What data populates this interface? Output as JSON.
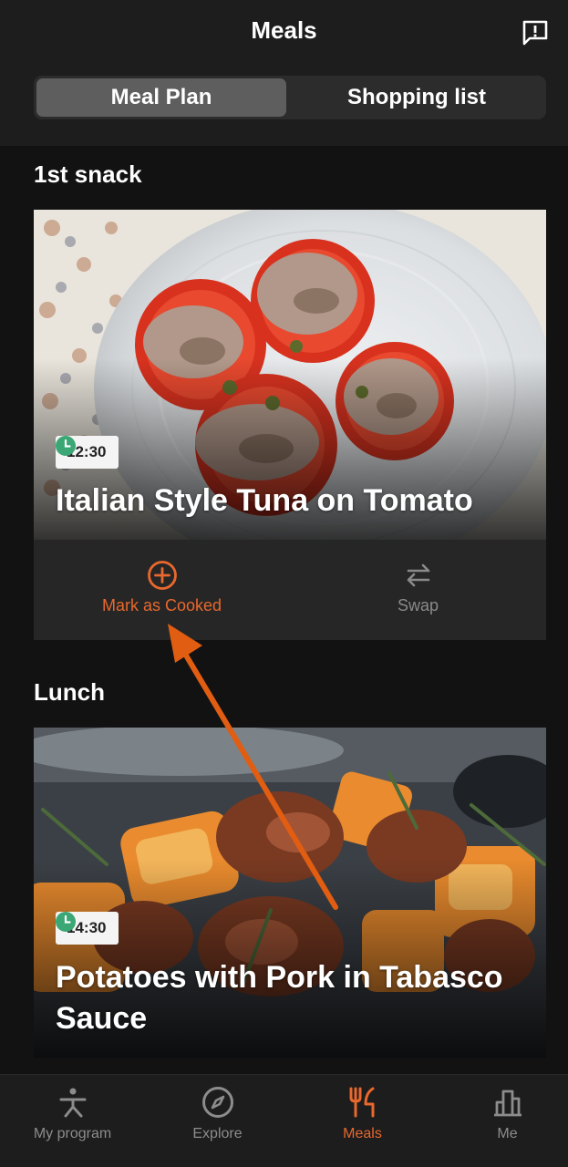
{
  "header": {
    "title": "Meals",
    "feedback_icon": "feedback-icon"
  },
  "segmented": {
    "items": [
      {
        "label": "Meal Plan",
        "selected": true
      },
      {
        "label": "Shopping list",
        "selected": false
      }
    ]
  },
  "meals": [
    {
      "section": "1st snack",
      "time": "12:30",
      "name": "Italian Style Tuna on Tomato",
      "actions": [
        {
          "label": "Mark as Cooked",
          "icon": "plus-circle-icon"
        },
        {
          "label": "Swap",
          "icon": "swap-icon"
        }
      ]
    },
    {
      "section": "Lunch",
      "time": "14:30",
      "name": "Potatoes with Pork in Tabasco Sauce"
    }
  ],
  "colors": {
    "accent": "#e8682d",
    "background": "#121212",
    "surface": "#1d1d1d"
  },
  "tabbar": {
    "items": [
      {
        "label": "My program",
        "icon": "stretch-figure-icon",
        "active": false
      },
      {
        "label": "Explore",
        "icon": "compass-icon",
        "active": false
      },
      {
        "label": "Meals",
        "icon": "fork-knife-icon",
        "active": true
      },
      {
        "label": "Me",
        "icon": "bar-chart-icon",
        "active": false
      }
    ]
  }
}
